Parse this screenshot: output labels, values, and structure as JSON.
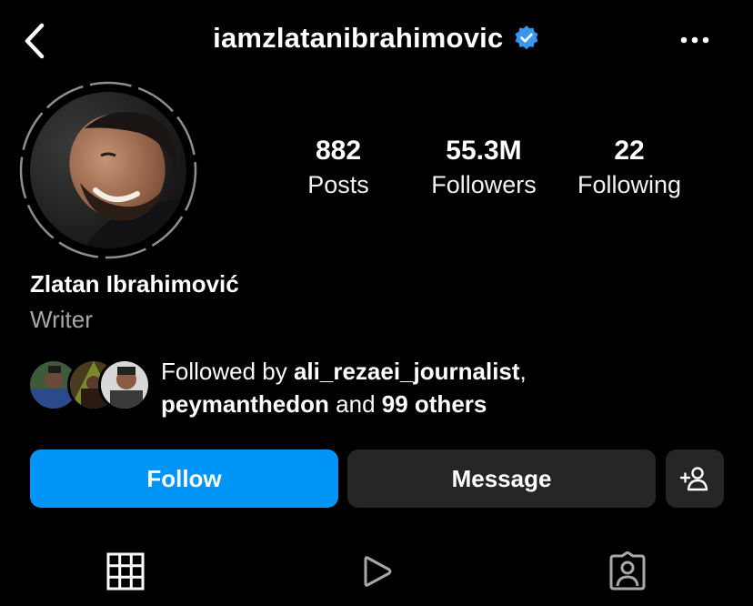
{
  "header": {
    "username": "iamzlatanibrahimovic",
    "verified": true
  },
  "profile": {
    "name": "Zlatan Ibrahimović",
    "category": "Writer"
  },
  "stats": [
    {
      "value": "882",
      "label": "Posts"
    },
    {
      "value": "55.3M",
      "label": "Followers"
    },
    {
      "value": "22",
      "label": "Following"
    }
  ],
  "followed_by": {
    "prefix": "Followed by ",
    "user1": "ali_rezaei_journalist",
    "separator": ",",
    "user2": "peymanthedon",
    "conj": " and ",
    "others": "99 others"
  },
  "actions": {
    "follow_label": "Follow",
    "message_label": "Message"
  },
  "tabs": [
    {
      "icon": "grid-icon"
    },
    {
      "icon": "reels-icon"
    },
    {
      "icon": "tagged-icon"
    }
  ],
  "colors": {
    "accent": "#0095f6",
    "verified": "#3897f0",
    "button_secondary": "#262626",
    "muted_text": "#a8a8a8"
  }
}
